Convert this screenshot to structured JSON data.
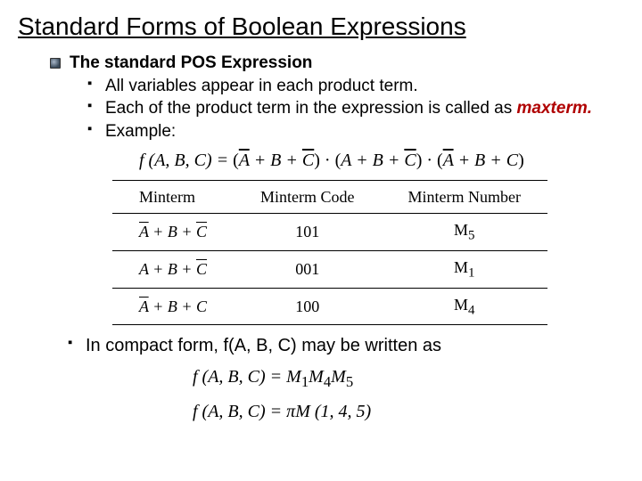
{
  "title": "Standard Forms of Boolean Expressions",
  "pos_heading": "The standard POS Expression",
  "bullets": {
    "b1": "All variables appear in each product term.",
    "b2a": "Each of the product term in the expression is called as",
    "b2b": "maxterm.",
    "b3": "Example:"
  },
  "main_eq": {
    "lhs": "f (A, B, C) = ",
    "t1a": "A",
    "t1b": " + B + ",
    "t1c": "C",
    "mid1": " · ",
    "t2a": "A + B + ",
    "t2b": "C",
    "mid2": " · ",
    "t3a": "A",
    "t3b": " + B + C",
    "lp": "(",
    "rp": ")"
  },
  "table": {
    "h1": "Minterm",
    "h2": "Minterm Code",
    "h3": "Minterm Number",
    "rows": [
      {
        "A_ov": true,
        "mid": " + B + ",
        "C_ov": true,
        "code": "101",
        "num": "M",
        "sub": "5"
      },
      {
        "A_ov": false,
        "mid": " + B + ",
        "C_ov": true,
        "code": "001",
        "num": "M",
        "sub": "1"
      },
      {
        "A_ov": true,
        "mid": " + B + ",
        "tail": "C",
        "code": "100",
        "num": "M",
        "sub": "4"
      }
    ]
  },
  "compact_line": "In compact form, f(A, B, C) may be written as",
  "compact_eq1": {
    "lhs": "f (A, B, C) = ",
    "m": "M",
    "s1": "1",
    "s2": "4",
    "s3": "5"
  },
  "compact_eq2": {
    "lhs": "f (A, B, C) = ",
    "pi": "π",
    "args": "M (1, 4, 5)"
  },
  "chart_data": {
    "type": "table",
    "title": "Maxterm codes and numbers",
    "columns": [
      "Minterm",
      "Minterm Code",
      "Minterm Number"
    ],
    "rows": [
      [
        "A' + B + C'",
        "101",
        "M5"
      ],
      [
        "A + B + C'",
        "001",
        "M1"
      ],
      [
        "A' + B + C",
        "100",
        "M4"
      ]
    ]
  }
}
